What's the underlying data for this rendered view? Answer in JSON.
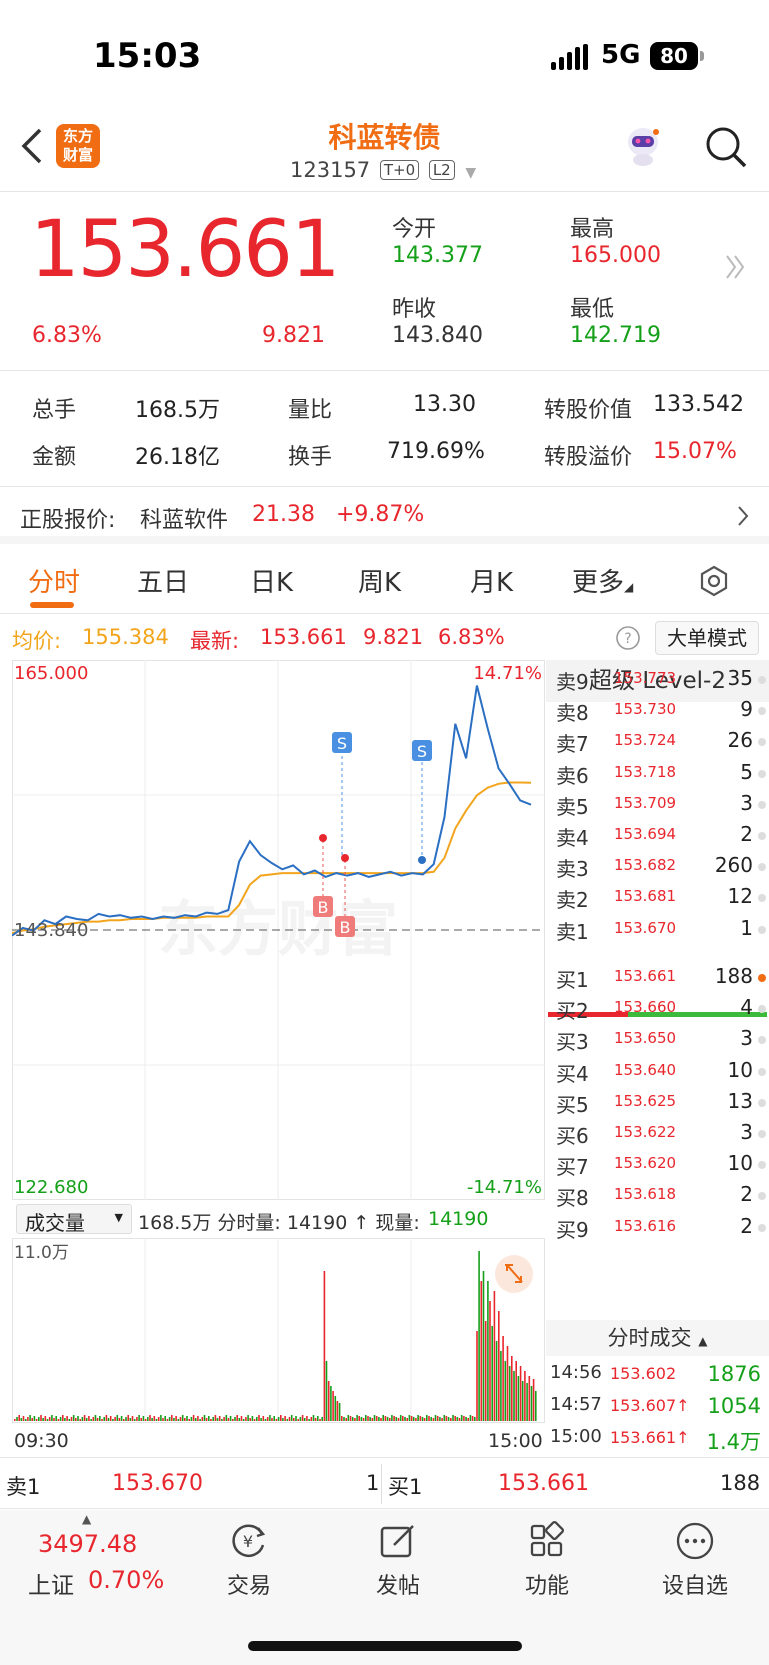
{
  "status": {
    "time": "15:03",
    "network": "5G",
    "battery": "80"
  },
  "nav": {
    "logo": "东方\n财富",
    "title": "科蓝转债",
    "code": "123157",
    "tag1": "T+0",
    "tag2": "L2"
  },
  "quote": {
    "price": "153.661",
    "change_pct": "6.83%",
    "change": "9.821",
    "open_label": "今开",
    "open": "143.377",
    "high_label": "最高",
    "high": "165.000",
    "prev_label": "昨收",
    "prev": "143.840",
    "low_label": "最低",
    "low": "142.719"
  },
  "stats": {
    "vol_label": "总手",
    "vol": "168.5万",
    "ratio_label": "量比",
    "ratio": "13.30",
    "conv_label": "转股价值",
    "conv": "133.542",
    "amt_label": "金额",
    "amt": "26.18亿",
    "turn_label": "换手",
    "turn": "719.69%",
    "prem_label": "转股溢价",
    "prem": "15.07%"
  },
  "stock": {
    "label": "正股报价:",
    "name": "科蓝软件",
    "price": "21.38",
    "pct": "+9.87%"
  },
  "tabs": [
    "分时",
    "五日",
    "日K",
    "周K",
    "月K",
    "更多"
  ],
  "info": {
    "avg_label": "均价:",
    "avg": "155.384",
    "last_label": "最新:",
    "last": "153.661",
    "chg": "9.821",
    "pct": "6.83%",
    "big_order": "大单模式"
  },
  "chart_data": {
    "type": "line",
    "title": "",
    "y_top": "165.000",
    "y_bottom": "122.680",
    "pct_top": "14.71%",
    "pct_bottom": "-14.71%",
    "ref_label": "143.840",
    "ylim": [
      122.68,
      165.0
    ],
    "reference": 143.84,
    "x_start": "09:30",
    "x_end": "15:00",
    "price": [
      143.4,
      144.0,
      143.8,
      144.6,
      144.3,
      144.9,
      144.7,
      144.6,
      145.1,
      144.9,
      145.0,
      144.8,
      144.9,
      144.7,
      144.9,
      144.8,
      145.0,
      144.9,
      145.2,
      145.1,
      145.4,
      149.2,
      150.8,
      149.7,
      149.1,
      148.6,
      148.9,
      148.2,
      148.5,
      148.0,
      148.3,
      148.1,
      148.3,
      148.0,
      148.2,
      148.4,
      148.1,
      148.3,
      148.2,
      149.0,
      152.7,
      160.0,
      157.3,
      163.0,
      159.6,
      156.5,
      155.3,
      154.0,
      153.661
    ],
    "avg": [
      143.6,
      143.8,
      143.9,
      144.1,
      144.2,
      144.3,
      144.4,
      144.5,
      144.5,
      144.6,
      144.6,
      144.7,
      144.7,
      144.7,
      144.8,
      144.8,
      144.8,
      144.8,
      144.9,
      144.9,
      144.9,
      145.8,
      147.4,
      148.1,
      148.2,
      148.3,
      148.3,
      148.3,
      148.3,
      148.3,
      148.3,
      148.3,
      148.3,
      148.3,
      148.3,
      148.3,
      148.3,
      148.3,
      148.3,
      148.4,
      149.5,
      151.8,
      153.2,
      154.4,
      155.0,
      155.3,
      155.4,
      155.4,
      155.384
    ],
    "markers": [
      {
        "label": "S"
      },
      {
        "label": "S"
      },
      {
        "label": "B"
      },
      {
        "label": "B"
      }
    ]
  },
  "volume": {
    "selector": "成交量",
    "summary": "168.5万 分时量: 14190 ↑ 现量:",
    "now": "14190",
    "max": "11.0万"
  },
  "level2": {
    "title": "超级 Level-2",
    "asks": [
      {
        "l": "卖9",
        "p": "153.773",
        "q": "35"
      },
      {
        "l": "卖8",
        "p": "153.730",
        "q": "9"
      },
      {
        "l": "卖7",
        "p": "153.724",
        "q": "26"
      },
      {
        "l": "卖6",
        "p": "153.718",
        "q": "5"
      },
      {
        "l": "卖5",
        "p": "153.709",
        "q": "3"
      },
      {
        "l": "卖4",
        "p": "153.694",
        "q": "2"
      },
      {
        "l": "卖3",
        "p": "153.682",
        "q": "260"
      },
      {
        "l": "卖2",
        "p": "153.681",
        "q": "12"
      },
      {
        "l": "卖1",
        "p": "153.670",
        "q": "1"
      }
    ],
    "bids": [
      {
        "l": "买1",
        "p": "153.661",
        "q": "188"
      },
      {
        "l": "买2",
        "p": "153.660",
        "q": "4"
      },
      {
        "l": "买3",
        "p": "153.650",
        "q": "3"
      },
      {
        "l": "买4",
        "p": "153.640",
        "q": "10"
      },
      {
        "l": "买5",
        "p": "153.625",
        "q": "13"
      },
      {
        "l": "买6",
        "p": "153.622",
        "q": "3"
      },
      {
        "l": "买7",
        "p": "153.620",
        "q": "10"
      },
      {
        "l": "买8",
        "p": "153.618",
        "q": "2"
      },
      {
        "l": "买9",
        "p": "153.616",
        "q": "2"
      }
    ],
    "trades_title": "分时成交",
    "trades": [
      {
        "t": "14:56",
        "p": "153.602",
        "q": "1876"
      },
      {
        "t": "14:57",
        "p": "153.607↑",
        "q": "1054"
      },
      {
        "t": "15:00",
        "p": "153.661↑",
        "q": "1.4万"
      }
    ]
  },
  "bottom_ob": {
    "ask_label": "卖1",
    "ask_price": "153.670",
    "ask_qty": "1",
    "bid_label": "买1",
    "bid_price": "153.661",
    "bid_qty": "188"
  },
  "footer": {
    "index": "3497.48",
    "index_name": "上证",
    "index_pct": "0.70%",
    "trade": "交易",
    "post": "发帖",
    "func": "功能",
    "watch": "设自选"
  }
}
